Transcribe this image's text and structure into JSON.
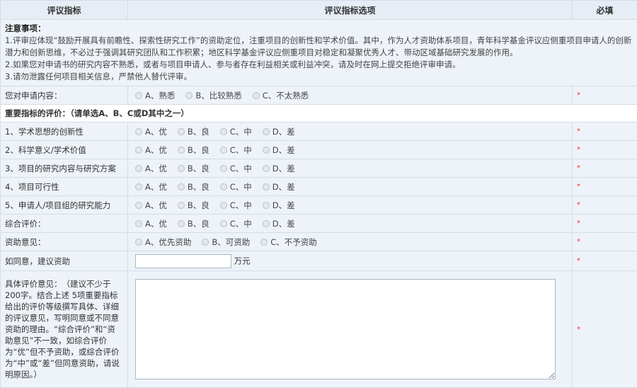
{
  "header": {
    "col1": "评议指标",
    "col2": "评议指标选项",
    "col3": "必填"
  },
  "notice": {
    "title": "注意事项：",
    "items": [
      "1.评审应体现“鼓励开展具有前瞻性、探索性研究工作”的资助定位，注重项目的创新性和学术价值。其中，作为人才资助体系项目，青年科学基金评议应侧重项目申请人的创新潜力和创新思维，不必过于强调其研究团队和工作积累；地区科学基金评议应侧重项目对稳定和凝聚优秀人才、带动区域基础研究发展的作用。",
      "2.如果您对申请书的研究内容不熟悉，或者与项目申请人、参与者存在利益相关或利益冲突，请及时在网上提交拒绝评审申请。",
      "3.请勿泄露任何项目相关信息，严禁他人替代评审。"
    ]
  },
  "familiarity": {
    "label": "您对申请内容：",
    "options": [
      "A、熟悉",
      "B、比较熟悉",
      "C、不太熟悉"
    ],
    "required": "*"
  },
  "section_heading": "重要指标的评价：（请单选A、B、C或D其中之一）",
  "grade_options": [
    "A、优",
    "B、良",
    "C、中",
    "D、差"
  ],
  "criteria": [
    {
      "label": "1、学术思想的创新性",
      "required": "*"
    },
    {
      "label": "2、科学意义/学术价值",
      "required": "*"
    },
    {
      "label": "3、项目的研究内容与研究方案",
      "required": "*"
    },
    {
      "label": "4、项目可行性",
      "required": "*"
    },
    {
      "label": "5、申请人/项目组的研究能力",
      "required": "*"
    },
    {
      "label": "综合评价：",
      "required": "*"
    }
  ],
  "funding": {
    "label": "资助意见：",
    "options": [
      "A、优先资助",
      "B、可资助",
      "C、不予资助"
    ],
    "required": "*"
  },
  "amount": {
    "label": "如同意，建议资助",
    "value": "",
    "unit": "万元",
    "required": "*"
  },
  "comments": {
    "label": "具体评价意见：　（建议不少于200字。结合上述 5项重要指标给出的评价等级撰写具体、详细的评议意见，写明同意或不同意资助的理由。“综合评价”和“资助意见”不一致，如综合评价为“优”但不予资助，或综合评价为“中”或“差”但同意资助，请说明原因。）",
    "value": "",
    "required": "*"
  }
}
